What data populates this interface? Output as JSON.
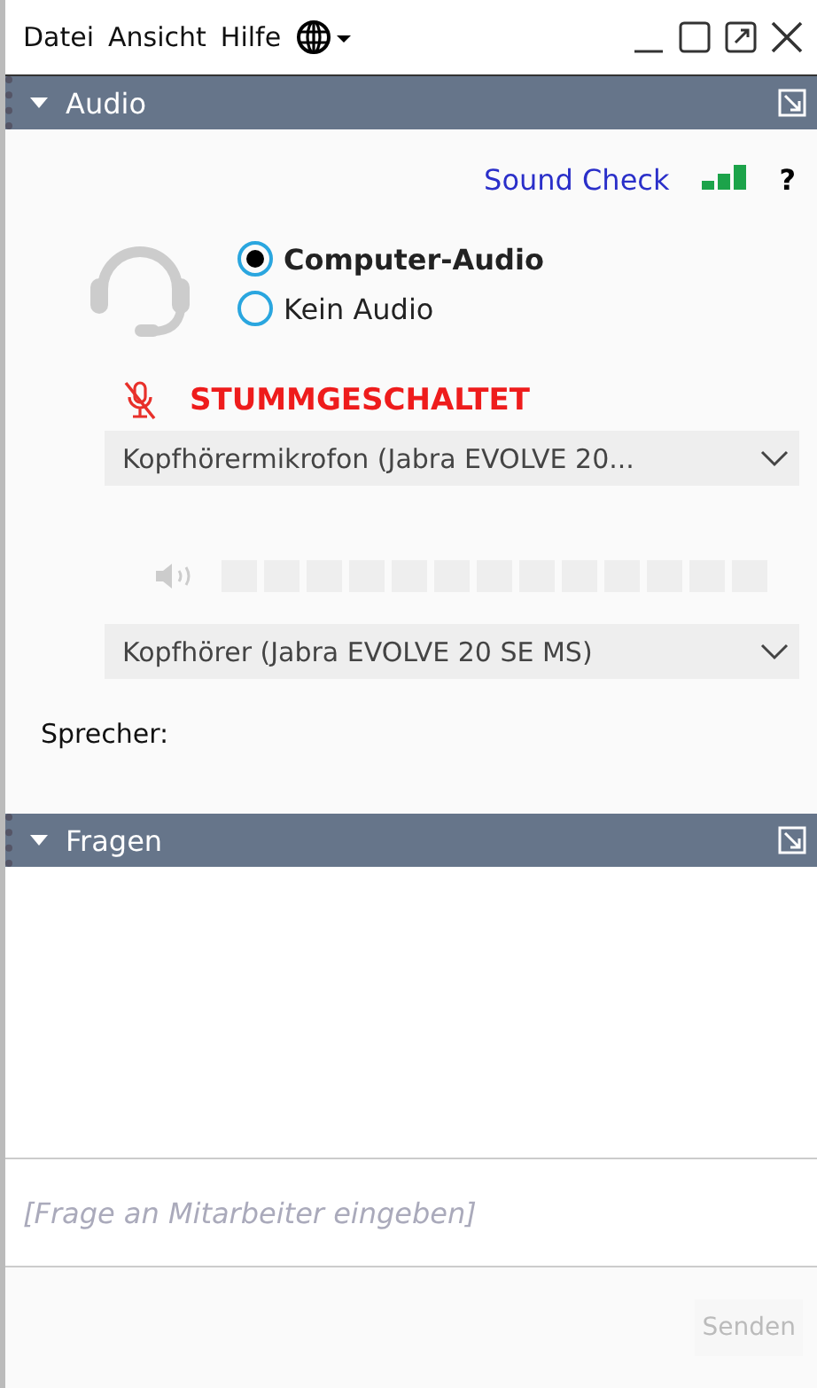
{
  "menu": [
    "Datei",
    "Ansicht",
    "Hilfe"
  ],
  "audio_panel": {
    "title": "Audio",
    "expanded": true,
    "sound_check": "Sound Check",
    "help": "?",
    "options": [
      {
        "label": "Computer-Audio",
        "selected": true
      },
      {
        "label": "Kein Audio",
        "selected": false
      }
    ],
    "mic_status": {
      "label": "STUMMGESCHALTET",
      "muted": true
    },
    "microphone": "Kopfhörermikrofon (Jabra EVOLVE 20...",
    "speaker_meter": {
      "level": 0
    },
    "speaker": "Kopfhörer (Jabra EVOLVE 20 SE MS)",
    "speaking_label": "Sprecher:"
  },
  "questions_panel": {
    "title": "Fragen",
    "expanded": true,
    "input": {
      "placeholder": "[Frage an Mitarbeiter eingeben]"
    },
    "send_button": {
      "label": "Senden",
      "disabled": true
    }
  }
}
